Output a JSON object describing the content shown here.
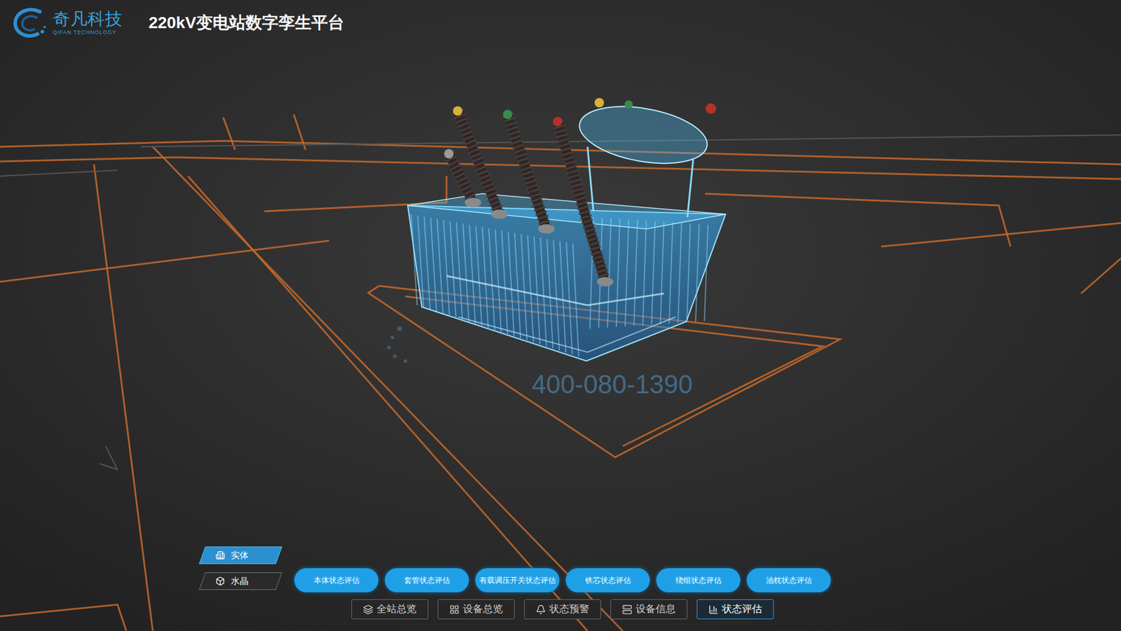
{
  "header": {
    "logo_name": "奇凡科技",
    "logo_subtitle": "QIFAN TECHNOLOGY",
    "title": "220kV变电站数字孪生平台"
  },
  "watermark": {
    "phone": "400-080-1390"
  },
  "view_toggle": [
    {
      "label": "实体",
      "selected": true
    },
    {
      "label": "水晶",
      "selected": false
    }
  ],
  "assessment_buttons": [
    "本体状态评估",
    "套管状态评估",
    "有载调压开关状态评估",
    "铁芯状态评估",
    "绕组状态评估",
    "油枕状态评估"
  ],
  "nav": [
    {
      "label": "全站总览",
      "selected": false
    },
    {
      "label": "设备总览",
      "selected": false
    },
    {
      "label": "状态预警",
      "selected": false
    },
    {
      "label": "设备信息",
      "selected": false
    },
    {
      "label": "状态评估",
      "selected": true
    }
  ]
}
